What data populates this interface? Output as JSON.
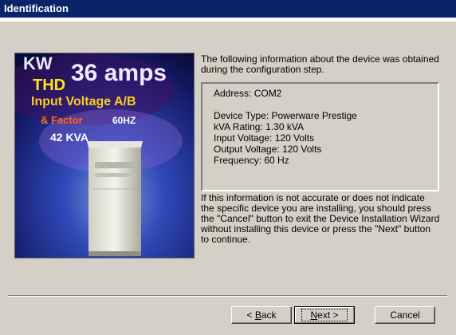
{
  "window": {
    "title": "Identification"
  },
  "illustration": {
    "texts": [
      "KW",
      "36 amps",
      "THD",
      "Input Voltage A/B",
      "& Factor",
      "60HZ",
      "42 KVA"
    ]
  },
  "intro_text": "The following information about the device was obtained during the configuration step.",
  "device_info": {
    "address": "Address: COM2",
    "device_type": "Device Type: Powerware Prestige",
    "kva_rating": "kVA Rating: 1.30 kVA",
    "input_voltage": "Input Voltage: 120 Volts",
    "output_voltage": "Output Voltage: 120 Volts",
    "frequency": "Frequency: 60 Hz"
  },
  "note_text": "If this information is not accurate or does not indicate the specific device you are installing, you should press the \"Cancel\" button to exit the Device Installation Wizard without installing this device or press the \"Next\" button to continue.",
  "buttons": {
    "back_prefix": "< ",
    "back_accel": "B",
    "back_rest": "ack",
    "next_accel": "N",
    "next_rest": "ext >",
    "cancel": "Cancel"
  }
}
